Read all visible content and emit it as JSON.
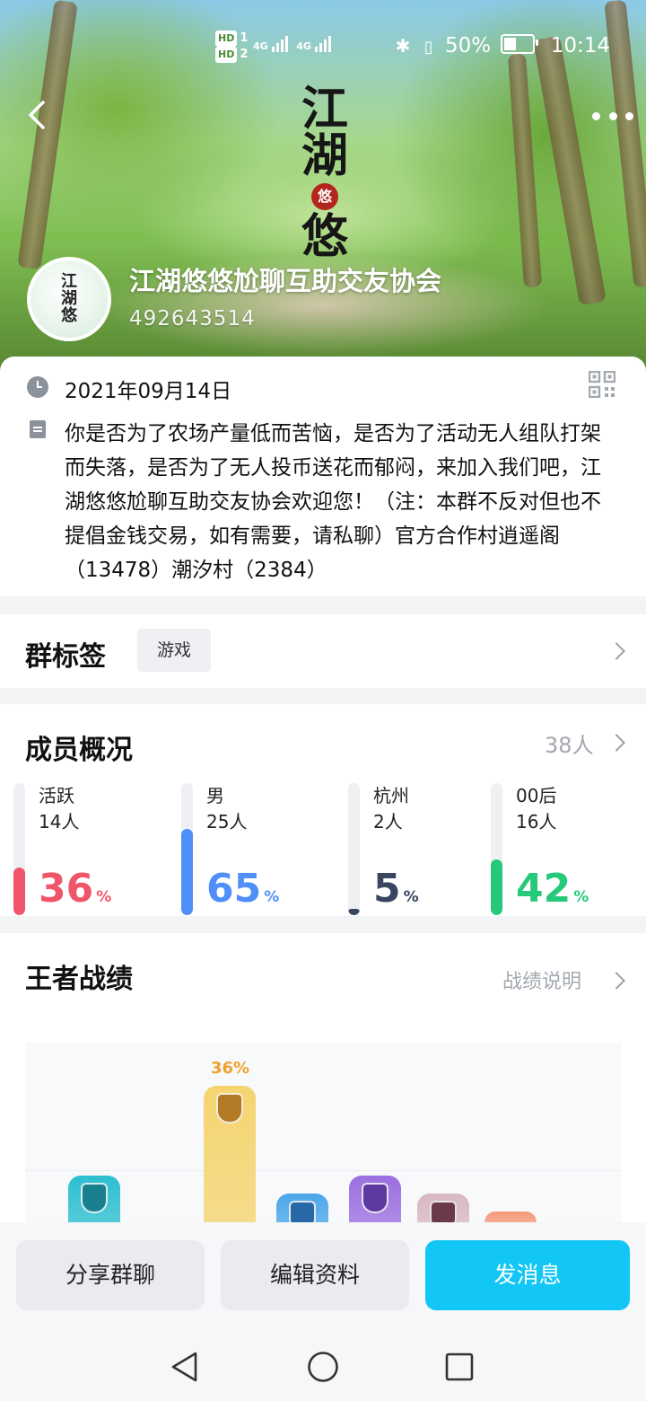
{
  "status_bar": {
    "sim1": "HD",
    "sim2": "HD",
    "network1": "4G",
    "network2": "4G",
    "battery_text": "50%",
    "battery_level": 0.5,
    "time": "10:14"
  },
  "header": {
    "logo_chars": [
      "江",
      "湖",
      "悠",
      "悠"
    ],
    "group_name": "江湖悠悠尬聊互助交友协会",
    "group_id": "492643514"
  },
  "info": {
    "date": "2021年09月14日",
    "description": "你是否为了农场产量低而苦恼，是否为了活动无人组队打架而失落，是否为了无人投币送花而郁闷，来加入我们吧，江湖悠悠尬聊互助交友协会欢迎您！（注：本群不反对但也不提倡金钱交易，如有需要，请私聊）官方合作村逍遥阁（13478）潮汐村（2384）"
  },
  "tags": {
    "title": "群标签",
    "items": [
      "游戏"
    ]
  },
  "members": {
    "title": "成员概况",
    "total": "38人",
    "stats": [
      {
        "label": "活跃",
        "count": "14人",
        "percent": 36,
        "color": "#f0566a"
      },
      {
        "label": "男",
        "count": "25人",
        "percent": 65,
        "color": "#4f8ff7"
      },
      {
        "label": "杭州",
        "count": "2人",
        "percent": 5,
        "color": "#3a4560"
      },
      {
        "label": "00后",
        "count": "16人",
        "percent": 42,
        "color": "#26c97a"
      }
    ],
    "percent_unit": "%"
  },
  "battle": {
    "title": "王者战绩",
    "link": "战绩说明",
    "top_percent": "36%",
    "ranks": [
      {
        "color": "#2cbfd0",
        "emblem": "#1a7f8f"
      },
      {
        "color": "#f5d470",
        "emblem": "#b27a25"
      },
      {
        "color": "#4aa6ea",
        "emblem": "#2868a8"
      },
      {
        "color": "#9b6fe0",
        "emblem": "#5c3aa0"
      },
      {
        "color": "#d8b7c4",
        "emblem": "#6a3a4a"
      },
      {
        "color": "#f59a7a",
        "emblem": "#f59a7a"
      }
    ]
  },
  "actions": {
    "share": "分享群聊",
    "edit": "编辑资料",
    "send": "发消息"
  }
}
